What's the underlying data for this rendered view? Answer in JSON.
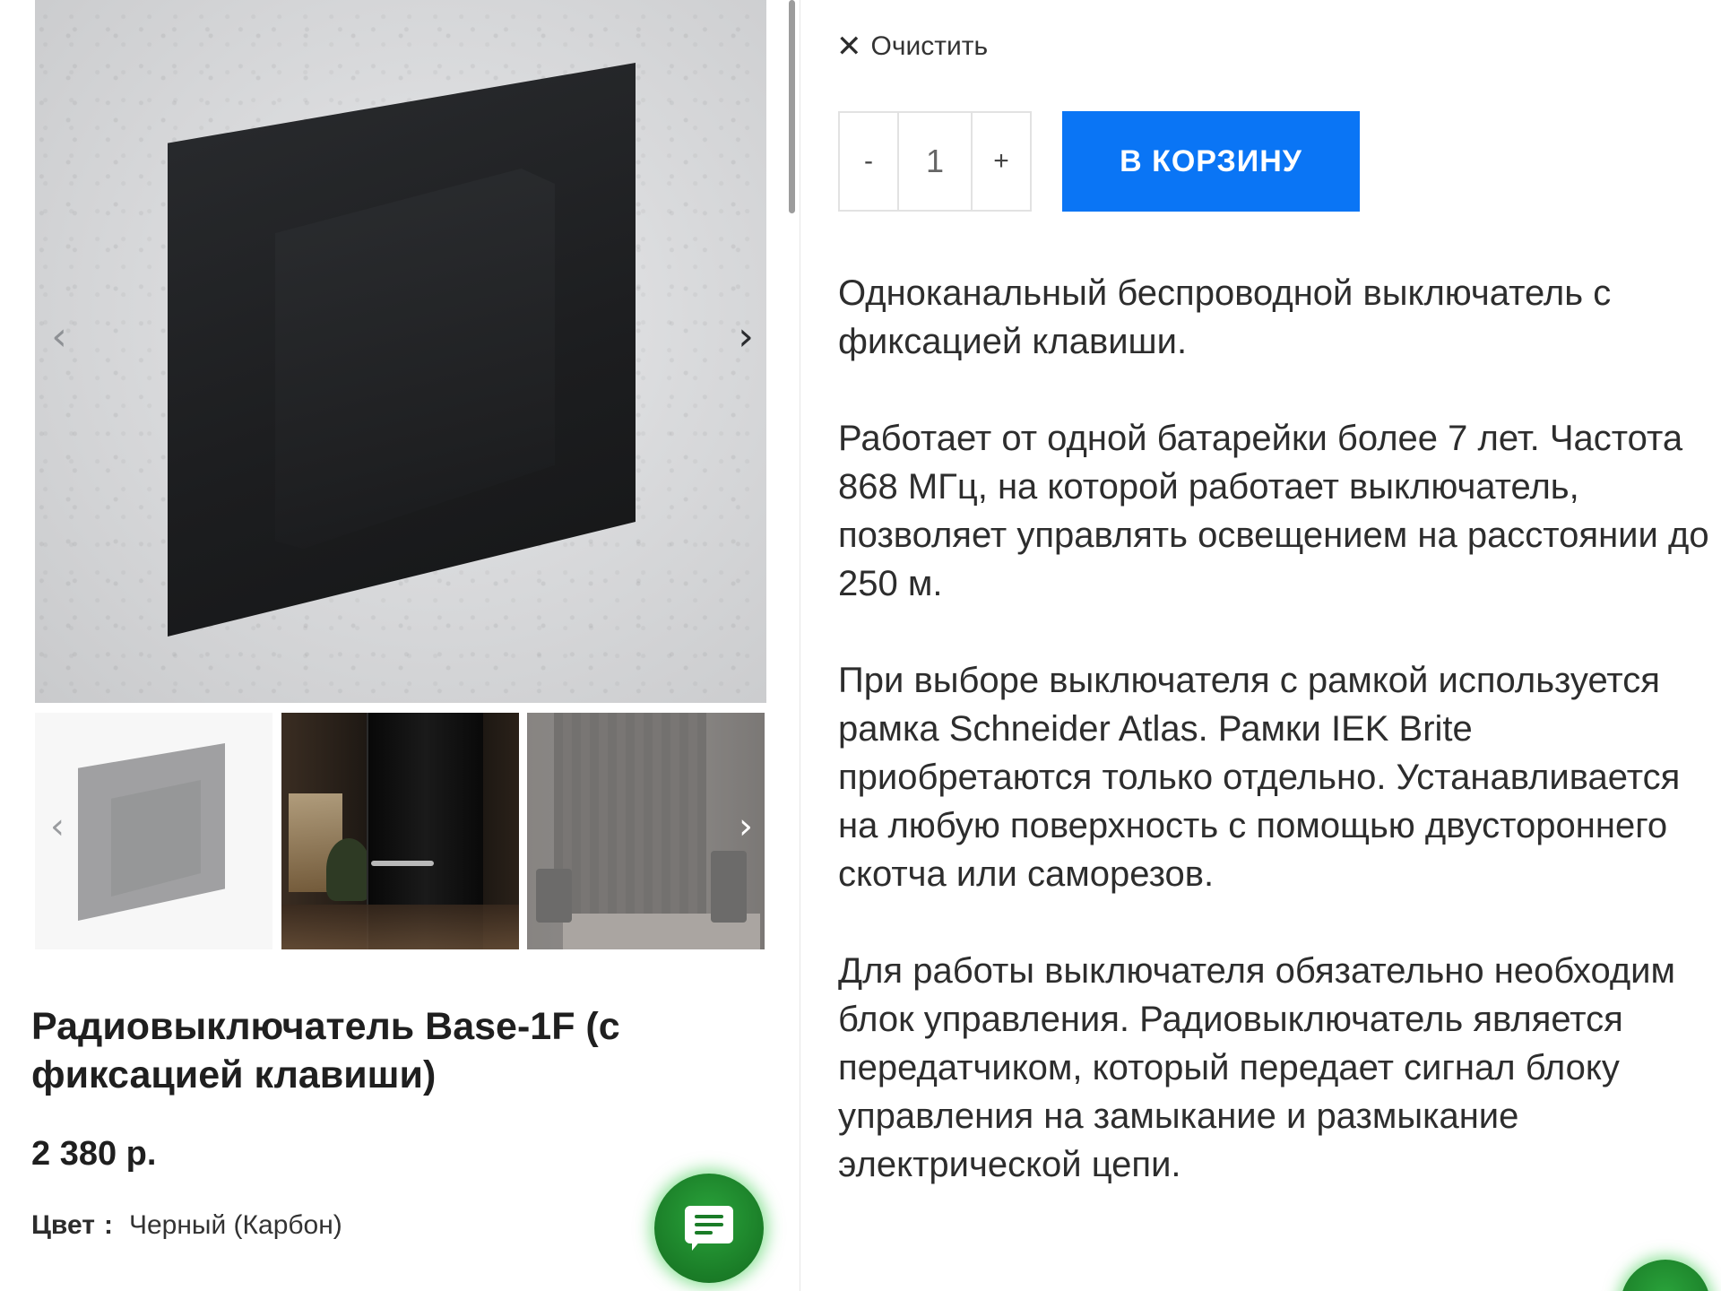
{
  "gallery": {
    "prev_icon": "‹",
    "next_icon": "›",
    "thumbs": [
      {
        "name": "switch-grey"
      },
      {
        "name": "interior-black-door"
      },
      {
        "name": "interior-grey-door"
      }
    ]
  },
  "product": {
    "title": "Радиовыключатель Base-1F (с фиксацией клавиши)",
    "price": "2 380 р.",
    "color_label": "Цвет",
    "color_separator": ":",
    "color_value": "Черный (Карбон)"
  },
  "actions": {
    "clear_icon": "✕",
    "clear_label": "Очистить",
    "qty_minus": "-",
    "qty_value": "1",
    "qty_plus": "+",
    "add_to_cart": "В КОРЗИНУ"
  },
  "description": [
    "Одноканальный беспроводной выключатель с фиксацией клавиши.",
    "Работает от одной батарейки более 7 лет. Частота 868 МГц, на которой работает выключатель, позволяет управлять освещением на расстоянии до 250 м.",
    "При выборе выключателя с рамкой используется рамка Schneider Atlas. Рамки IEK Brite приобретаются только отдельно. Устанавливается на любую поверхность с помощью двустороннего скотча или саморезов.",
    "Для работы выключателя обязательно необходим блок управления. Радиовыключатель является передатчиком, который передает сигнал блоку управления на замыкание и размыкание электрической цепи."
  ],
  "colors": {
    "accent": "#0a75f5",
    "chat": "#1a7c27"
  }
}
